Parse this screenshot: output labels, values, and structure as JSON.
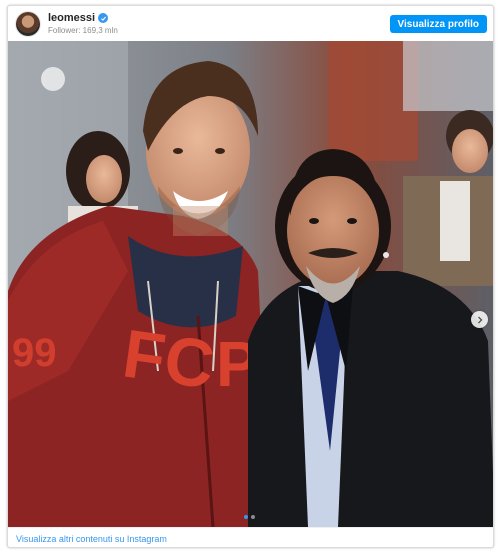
{
  "header": {
    "username": "leomessi",
    "followers": "Follower: 169,3 mln",
    "profile_button": "Visualizza profilo"
  },
  "post": {
    "carousel_dots": 2,
    "active_dot": 0
  },
  "footer": {
    "link": "Visualizza altri contenuti su Instagram"
  },
  "colors": {
    "accent": "#0095f6",
    "link": "#3897f0"
  },
  "icons": {
    "verified": "verified-badge-icon",
    "next": "chevron-right-icon"
  }
}
